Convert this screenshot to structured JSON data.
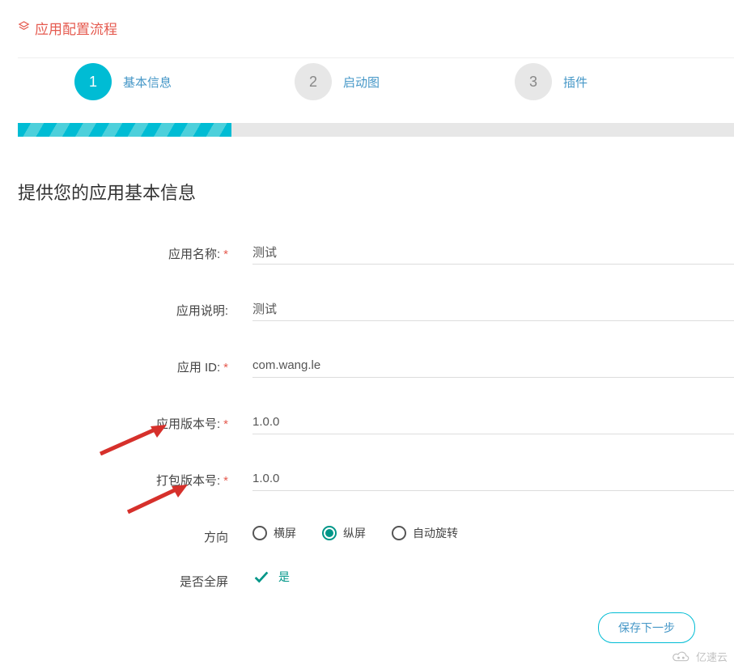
{
  "header": {
    "title": "应用配置流程"
  },
  "steps": [
    {
      "num": "1",
      "label": "基本信息"
    },
    {
      "num": "2",
      "label": "启动图"
    },
    {
      "num": "3",
      "label": "插件"
    }
  ],
  "page_sub": "提供您的应用基本信息",
  "form": {
    "app_name_label": "应用名称:",
    "app_name_value": "测试",
    "app_desc_label": "应用说明:",
    "app_desc_value": "测试",
    "app_id_label": "应用 ID:",
    "app_id_value": "com.wang.le",
    "app_version_label": "应用版本号:",
    "app_version_value": "1.0.0",
    "pack_version_label": "打包版本号:",
    "pack_version_value": "1.0.0",
    "orientation_label": "方向",
    "orientation_options": {
      "landscape": "横屏",
      "portrait": "纵屏",
      "auto": "自动旋转"
    },
    "fullscreen_label": "是否全屏",
    "fullscreen_value": "是"
  },
  "buttons": {
    "save": "保存下一步"
  },
  "watermark": {
    "text": "亿速云"
  }
}
